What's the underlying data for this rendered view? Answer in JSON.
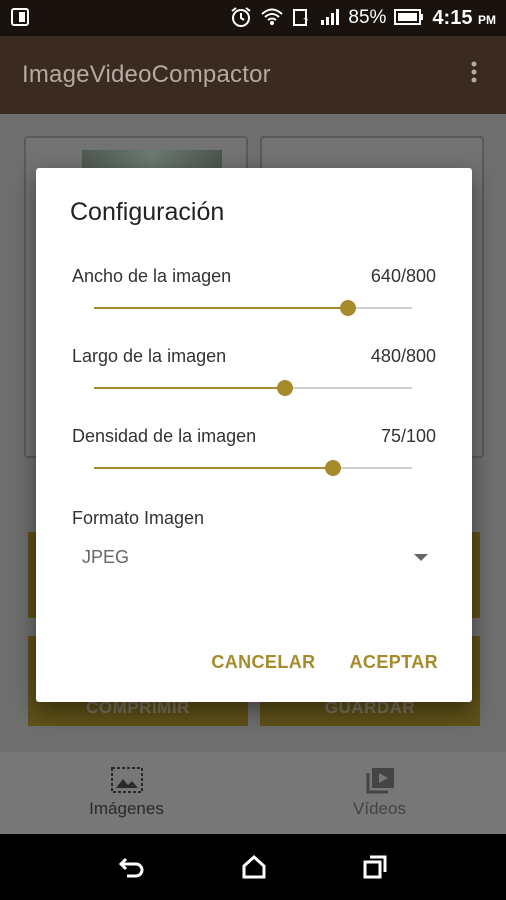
{
  "status_bar": {
    "battery_percent": "85%",
    "time": "4:15",
    "ampm": "PM",
    "icons": [
      "sim-icon",
      "alarm-icon",
      "wifi-icon",
      "data-icon",
      "signal-icon",
      "battery-icon"
    ]
  },
  "app_bar": {
    "title": "ImageVideoCompactor",
    "overflow_icon": "more-vert-icon"
  },
  "background": {
    "buttons": [
      "COMPRIMIR",
      "GUARDAR"
    ],
    "bottom_nav": [
      {
        "label": "Imágenes",
        "icon": "image-icon",
        "active": true
      },
      {
        "label": "Vídeos",
        "icon": "video-library-icon",
        "active": false
      }
    ]
  },
  "dialog": {
    "title": "Configuración",
    "settings": [
      {
        "label": "Ancho de la imagen",
        "value_text": "640/800",
        "value": 640,
        "max": 800
      },
      {
        "label": "Largo de la imagen",
        "value_text": "480/800",
        "value": 480,
        "max": 800
      },
      {
        "label": "Densidad de la imagen",
        "value_text": "75/100",
        "value": 75,
        "max": 100
      }
    ],
    "format_label": "Formato Imagen",
    "format_value": "JPEG",
    "cancel_label": "CANCELAR",
    "accept_label": "ACEPTAR"
  },
  "colors": {
    "accent": "#a68a2c",
    "app_bar": "#3a2a20",
    "status_bar": "#1a120c"
  },
  "system_nav": [
    "back-icon",
    "home-icon",
    "recents-icon"
  ]
}
